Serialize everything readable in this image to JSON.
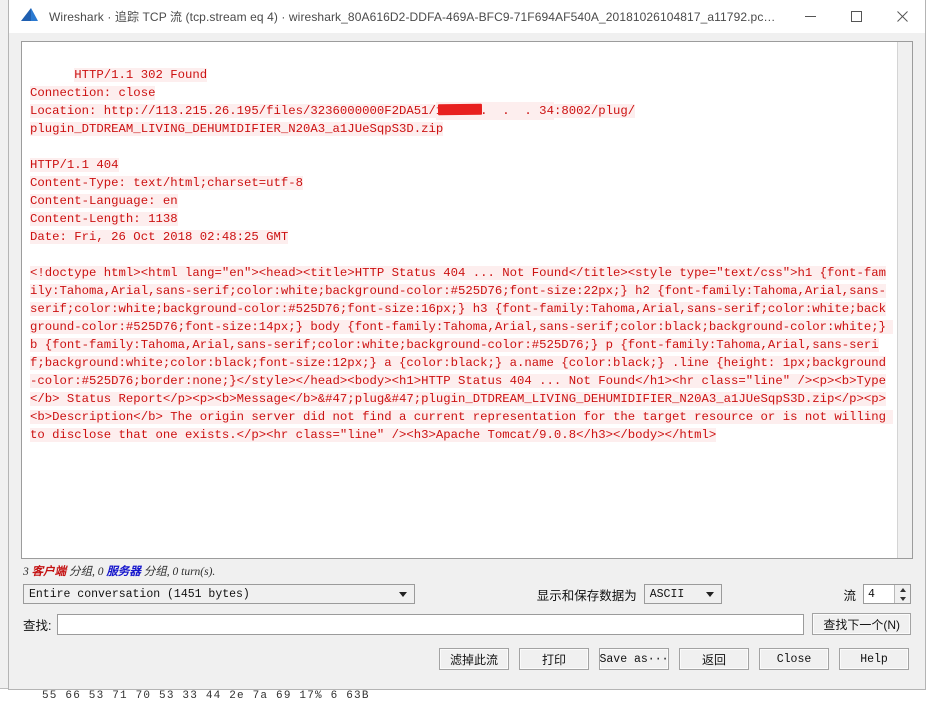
{
  "window": {
    "title": "Wireshark · 追踪 TCP 流 (tcp.stream eq 4) · wireshark_80A616D2-DDFA-469A-BFC9-71F694AF540A_20181026104817_a11792.pc…",
    "icon": "wireshark-fin-icon",
    "minimize_label": "—",
    "maximize_label": "☐",
    "close_label": "✕"
  },
  "stream": {
    "segments": [
      {
        "text": "HTTP/1.1 302 Found\nConnection: close\nLocation: http://113.215.26.195/files/3236000000F2DA51/",
        "direction": "server"
      },
      {
        "text": "119.  .  .  . 34",
        "direction": "server",
        "redacted": true
      },
      {
        "text": ":8002/plug/\nplugin_DTDREAM_LIVING_DEHUMIDIFIER_N20A3_a1JUeSqpS3D.zip\n\nHTTP/1.1 404\nContent-Type: text/html;charset=utf-8\nContent-Language: en\nContent-Length: 1138\nDate: Fri, 26 Oct 2018 02:48:25 GMT\n\n<!doctype html><html lang=\"en\"><head><title>HTTP Status 404 ... Not Found</title><style type=\"text/css\">h1 {font-family:Tahoma,Arial,sans-serif;color:white;background-color:#525D76;font-size:22px;} h2 {font-family:Tahoma,Arial,sans-serif;color:white;background-color:#525D76;font-size:16px;} h3 {font-family:Tahoma,Arial,sans-serif;color:white;background-color:#525D76;font-size:14px;} body {font-family:Tahoma,Arial,sans-serif;color:black;background-color:white;} b {font-family:Tahoma,Arial,sans-serif;color:white;background-color:#525D76;} p {font-family:Tahoma,Arial,sans-serif;background:white;color:black;font-size:12px;} a {color:black;} a.name {color:black;} .line {height: 1px;background-color:#525D76;border:none;}</style></head><body><h1>HTTP Status 404 ... Not Found</h1><hr class=\"line\" /><p><b>Type</b> Status Report</p><p><b>Message</b>&#47;plug&#47;plugin_DTDREAM_LIVING_DEHUMIDIFIER_N20A3_a1JUeSqpS3D.zip</p><p><b>Description</b> The origin server did not find a current representation for the target resource or is not willing to disclose that one exists.</p><hr class=\"line\" /><h3>Apache Tomcat/9.0.8</h3></body></html>",
        "direction": "server"
      }
    ]
  },
  "status": {
    "count_client": "3",
    "client_word": "客户端",
    "mid_1": "分组,",
    "count_server": "0",
    "server_word": "服务器",
    "mid_2": "分组,",
    "turns": "0 turn(s)."
  },
  "controls": {
    "conversation_value": "Entire conversation (1451 bytes)",
    "show_save_label": "显示和保存数据为",
    "encoding_value": "ASCII",
    "stream_label": "流",
    "stream_value": "4",
    "find_label": "查找:",
    "find_value": "",
    "find_placeholder": "",
    "find_next_label": "查找下一个(N)"
  },
  "buttons": {
    "filter_out": "滤掉此流",
    "print": "打印",
    "save_as": "Save as···",
    "back": "返回",
    "close": "Close",
    "help": "Help"
  },
  "background": {
    "hex_row": "55 66  53 71 70 53 33 44 2e  7a     69   17%  6   63B"
  },
  "colors": {
    "server_text": "#cc1111",
    "server_bg": "#fdeeee",
    "client_label": "#c41212",
    "server_label": "#1515cc",
    "redaction": "#e8201f"
  }
}
